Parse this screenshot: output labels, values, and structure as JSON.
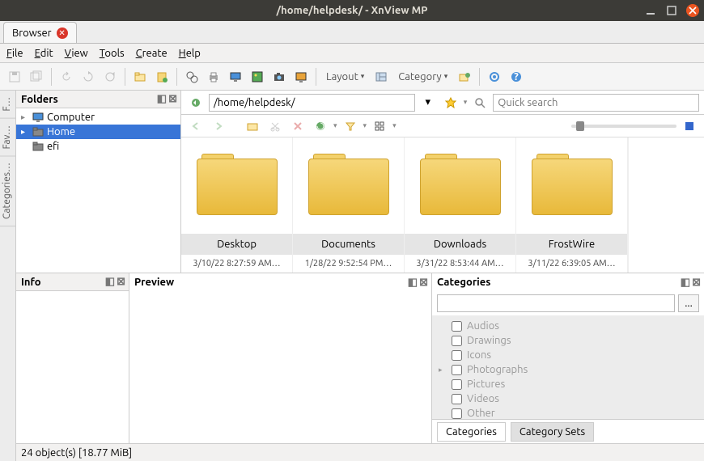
{
  "window": {
    "title": "/home/helpdesk/ - XnView MP"
  },
  "tabstrip": {
    "label": "Browser"
  },
  "menu": {
    "file": "File",
    "edit": "Edit",
    "view": "View",
    "tools": "Tools",
    "create": "Create",
    "help": "Help"
  },
  "toolbar": {
    "layout": "Layout",
    "category": "Category"
  },
  "addressbar": {
    "path": "/home/helpdesk/",
    "search_placeholder": "Quick search"
  },
  "sidetabs": {
    "f": "F…",
    "fav": "Fav…",
    "categories": "Categories…"
  },
  "panes": {
    "folders": "Folders",
    "info": "Info",
    "preview": "Preview",
    "categories": "Categories"
  },
  "tree": {
    "items": [
      {
        "label": "Computer",
        "expandable": true,
        "selected": false,
        "icon": "monitor"
      },
      {
        "label": "Home",
        "expandable": true,
        "selected": true,
        "icon": "folder"
      },
      {
        "label": "efi",
        "expandable": false,
        "selected": false,
        "icon": "folder"
      }
    ]
  },
  "thumbs": [
    {
      "label": "Desktop",
      "date": "3/10/22 8:27:59 AM…"
    },
    {
      "label": "Documents",
      "date": "1/28/22 9:52:54 PM…"
    },
    {
      "label": "Downloads",
      "date": "3/31/22 8:53:44 AM…"
    },
    {
      "label": "FrostWire",
      "date": "3/11/22 6:39:05 AM…"
    }
  ],
  "categories": {
    "items": [
      "Audios",
      "Drawings",
      "Icons",
      "Photographs",
      "Pictures",
      "Videos",
      "Other"
    ],
    "tabs": {
      "categories": "Categories",
      "sets": "Category Sets"
    },
    "more": "..."
  },
  "status": {
    "text": "24 object(s) [18.77 MiB]"
  }
}
